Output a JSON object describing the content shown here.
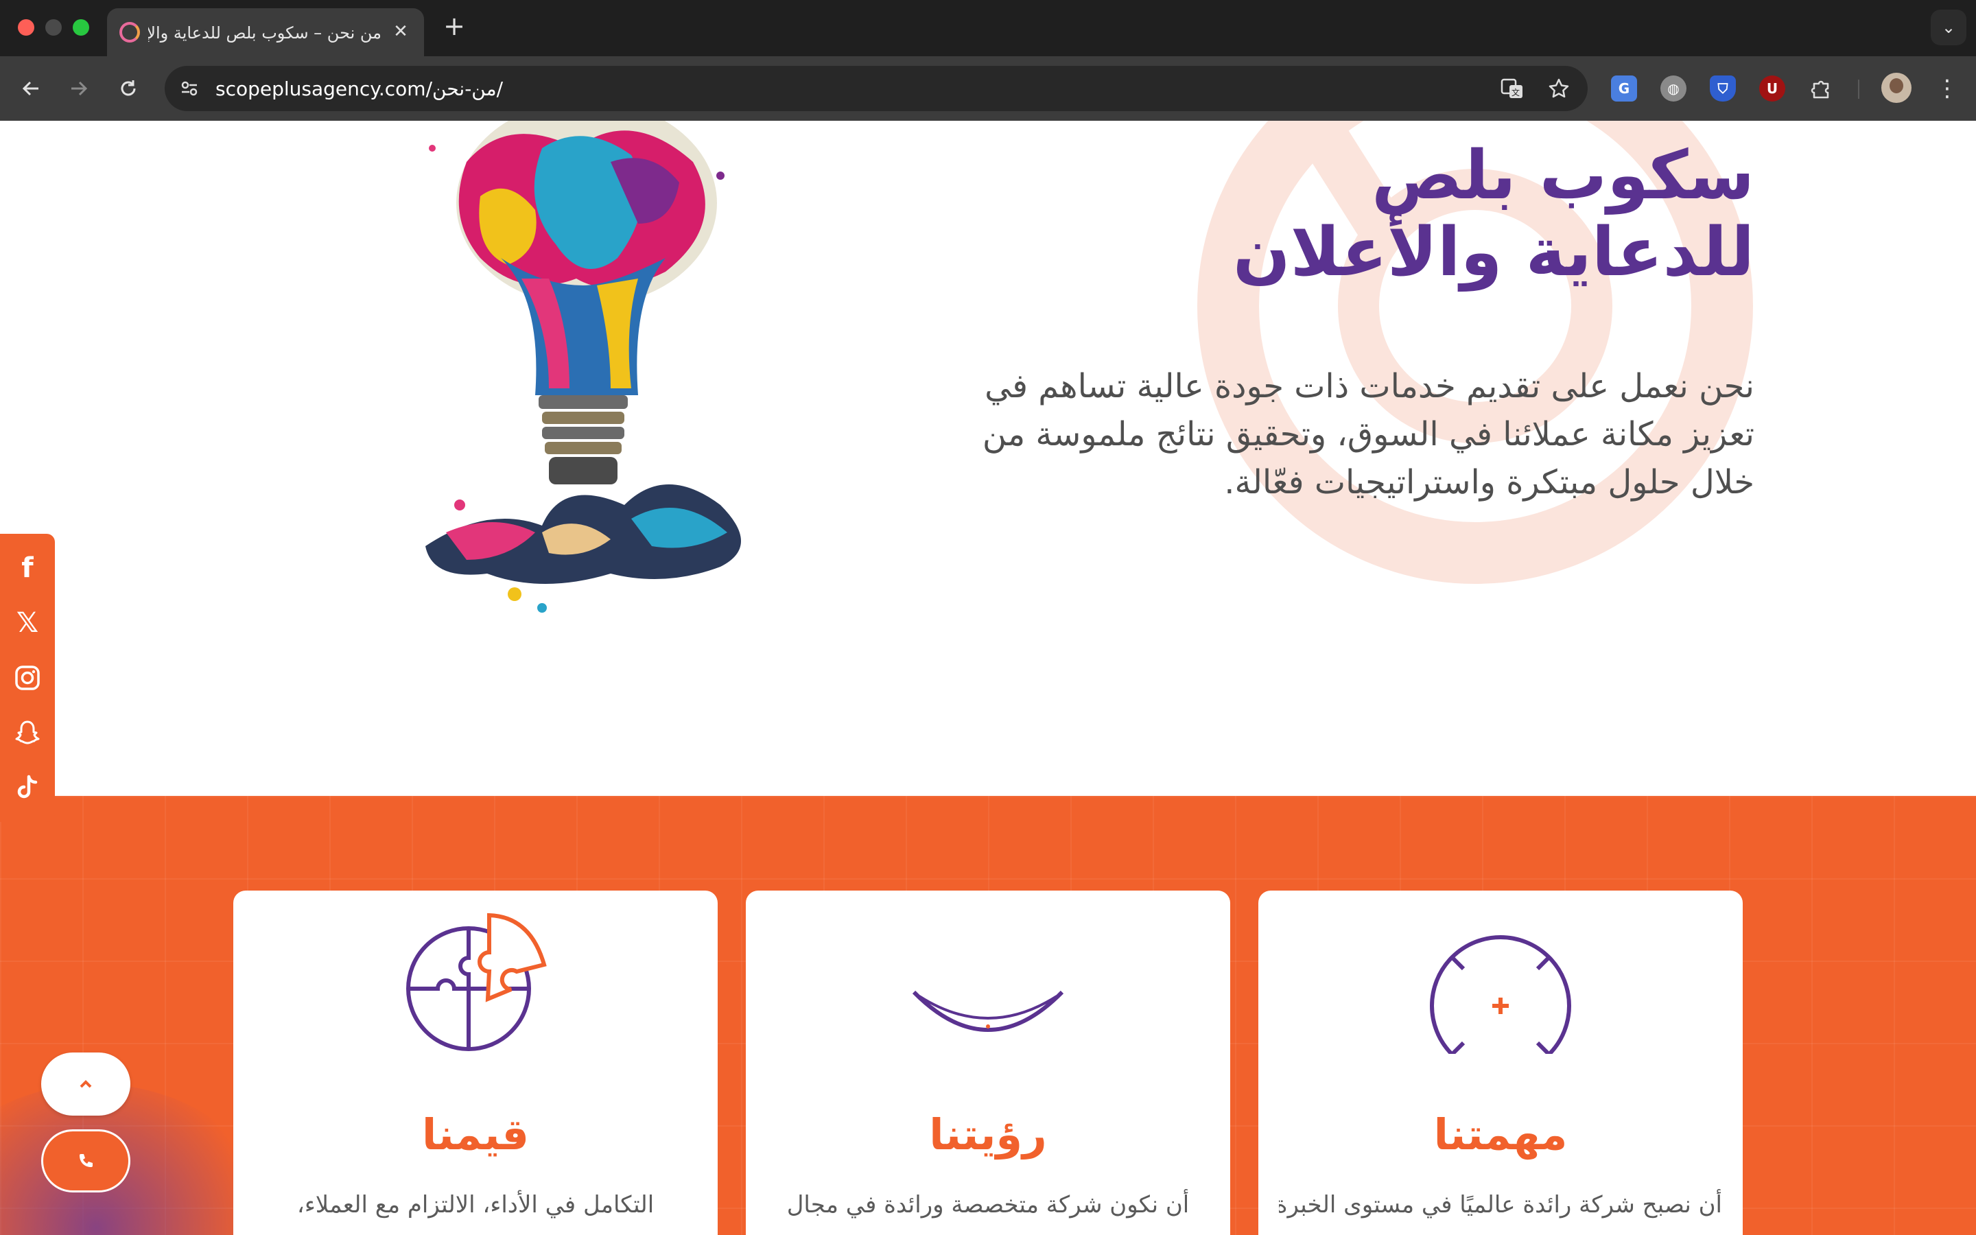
{
  "browser": {
    "tab_title": "من نحن – سكوب بلص للدعاية والإعلان",
    "tab_close": "✕",
    "new_tab": "+",
    "tab_menu": "⌄",
    "url": "scopeplusagency.com/من-نحن/",
    "icons": [
      "back-icon",
      "forward-icon",
      "reload-icon",
      "site-info-icon",
      "translate-icon",
      "bookmark-star-icon",
      "extension-icons",
      "profile-avatar",
      "menu-icon"
    ]
  },
  "hero": {
    "title": "سكوب بلص\nللدعاية والأعلان",
    "text": "نحن نعمل على تقديم خدمات ذات جودة عالية تساهم في تعزيز مكانة عملائنا في السوق، وتحقيق نتائج ملموسة من خلال حلول مبتكرة واستراتيجيات فعّالة."
  },
  "social": [
    "facebook",
    "x",
    "instagram",
    "snapchat",
    "tiktok"
  ],
  "cards": [
    {
      "id": "values",
      "title": "قيمنا",
      "text": "التكامل في الأداء، الالتزام مع العملاء،",
      "icon": "puzzle-icon"
    },
    {
      "id": "vision",
      "title": "رؤيتنا",
      "text": "أن نكون شركة متخصصة ورائدة في مجال",
      "icon": "eye-icon"
    },
    {
      "id": "mission",
      "title": "مهمتنا",
      "text": "أن نصبح شركة رائدة عالميًا في مستوى الخبرة",
      "icon": "target-icon"
    }
  ],
  "colors": {
    "accent": "#f1612c",
    "brand_purple": "#5a3290"
  }
}
